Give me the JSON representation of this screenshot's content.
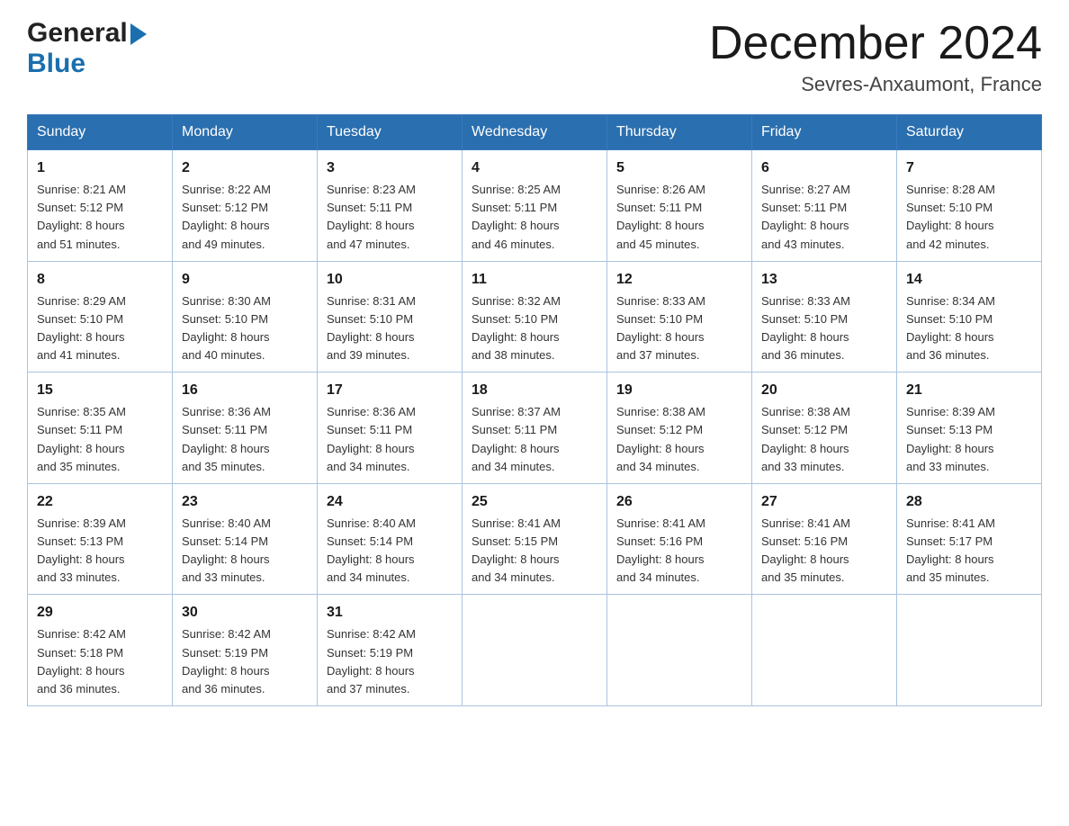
{
  "header": {
    "logo_general": "General",
    "logo_blue": "Blue",
    "month_title": "December 2024",
    "location": "Sevres-Anxaumont, France"
  },
  "columns": [
    "Sunday",
    "Monday",
    "Tuesday",
    "Wednesday",
    "Thursday",
    "Friday",
    "Saturday"
  ],
  "weeks": [
    [
      {
        "day": "1",
        "sunrise": "8:21 AM",
        "sunset": "5:12 PM",
        "daylight": "8 hours and 51 minutes."
      },
      {
        "day": "2",
        "sunrise": "8:22 AM",
        "sunset": "5:12 PM",
        "daylight": "8 hours and 49 minutes."
      },
      {
        "day": "3",
        "sunrise": "8:23 AM",
        "sunset": "5:11 PM",
        "daylight": "8 hours and 47 minutes."
      },
      {
        "day": "4",
        "sunrise": "8:25 AM",
        "sunset": "5:11 PM",
        "daylight": "8 hours and 46 minutes."
      },
      {
        "day": "5",
        "sunrise": "8:26 AM",
        "sunset": "5:11 PM",
        "daylight": "8 hours and 45 minutes."
      },
      {
        "day": "6",
        "sunrise": "8:27 AM",
        "sunset": "5:11 PM",
        "daylight": "8 hours and 43 minutes."
      },
      {
        "day": "7",
        "sunrise": "8:28 AM",
        "sunset": "5:10 PM",
        "daylight": "8 hours and 42 minutes."
      }
    ],
    [
      {
        "day": "8",
        "sunrise": "8:29 AM",
        "sunset": "5:10 PM",
        "daylight": "8 hours and 41 minutes."
      },
      {
        "day": "9",
        "sunrise": "8:30 AM",
        "sunset": "5:10 PM",
        "daylight": "8 hours and 40 minutes."
      },
      {
        "day": "10",
        "sunrise": "8:31 AM",
        "sunset": "5:10 PM",
        "daylight": "8 hours and 39 minutes."
      },
      {
        "day": "11",
        "sunrise": "8:32 AM",
        "sunset": "5:10 PM",
        "daylight": "8 hours and 38 minutes."
      },
      {
        "day": "12",
        "sunrise": "8:33 AM",
        "sunset": "5:10 PM",
        "daylight": "8 hours and 37 minutes."
      },
      {
        "day": "13",
        "sunrise": "8:33 AM",
        "sunset": "5:10 PM",
        "daylight": "8 hours and 36 minutes."
      },
      {
        "day": "14",
        "sunrise": "8:34 AM",
        "sunset": "5:10 PM",
        "daylight": "8 hours and 36 minutes."
      }
    ],
    [
      {
        "day": "15",
        "sunrise": "8:35 AM",
        "sunset": "5:11 PM",
        "daylight": "8 hours and 35 minutes."
      },
      {
        "day": "16",
        "sunrise": "8:36 AM",
        "sunset": "5:11 PM",
        "daylight": "8 hours and 35 minutes."
      },
      {
        "day": "17",
        "sunrise": "8:36 AM",
        "sunset": "5:11 PM",
        "daylight": "8 hours and 34 minutes."
      },
      {
        "day": "18",
        "sunrise": "8:37 AM",
        "sunset": "5:11 PM",
        "daylight": "8 hours and 34 minutes."
      },
      {
        "day": "19",
        "sunrise": "8:38 AM",
        "sunset": "5:12 PM",
        "daylight": "8 hours and 34 minutes."
      },
      {
        "day": "20",
        "sunrise": "8:38 AM",
        "sunset": "5:12 PM",
        "daylight": "8 hours and 33 minutes."
      },
      {
        "day": "21",
        "sunrise": "8:39 AM",
        "sunset": "5:13 PM",
        "daylight": "8 hours and 33 minutes."
      }
    ],
    [
      {
        "day": "22",
        "sunrise": "8:39 AM",
        "sunset": "5:13 PM",
        "daylight": "8 hours and 33 minutes."
      },
      {
        "day": "23",
        "sunrise": "8:40 AM",
        "sunset": "5:14 PM",
        "daylight": "8 hours and 33 minutes."
      },
      {
        "day": "24",
        "sunrise": "8:40 AM",
        "sunset": "5:14 PM",
        "daylight": "8 hours and 34 minutes."
      },
      {
        "day": "25",
        "sunrise": "8:41 AM",
        "sunset": "5:15 PM",
        "daylight": "8 hours and 34 minutes."
      },
      {
        "day": "26",
        "sunrise": "8:41 AM",
        "sunset": "5:16 PM",
        "daylight": "8 hours and 34 minutes."
      },
      {
        "day": "27",
        "sunrise": "8:41 AM",
        "sunset": "5:16 PM",
        "daylight": "8 hours and 35 minutes."
      },
      {
        "day": "28",
        "sunrise": "8:41 AM",
        "sunset": "5:17 PM",
        "daylight": "8 hours and 35 minutes."
      }
    ],
    [
      {
        "day": "29",
        "sunrise": "8:42 AM",
        "sunset": "5:18 PM",
        "daylight": "8 hours and 36 minutes."
      },
      {
        "day": "30",
        "sunrise": "8:42 AM",
        "sunset": "5:19 PM",
        "daylight": "8 hours and 36 minutes."
      },
      {
        "day": "31",
        "sunrise": "8:42 AM",
        "sunset": "5:19 PM",
        "daylight": "8 hours and 37 minutes."
      },
      null,
      null,
      null,
      null
    ]
  ],
  "labels": {
    "sunrise": "Sunrise:",
    "sunset": "Sunset:",
    "daylight": "Daylight:"
  }
}
